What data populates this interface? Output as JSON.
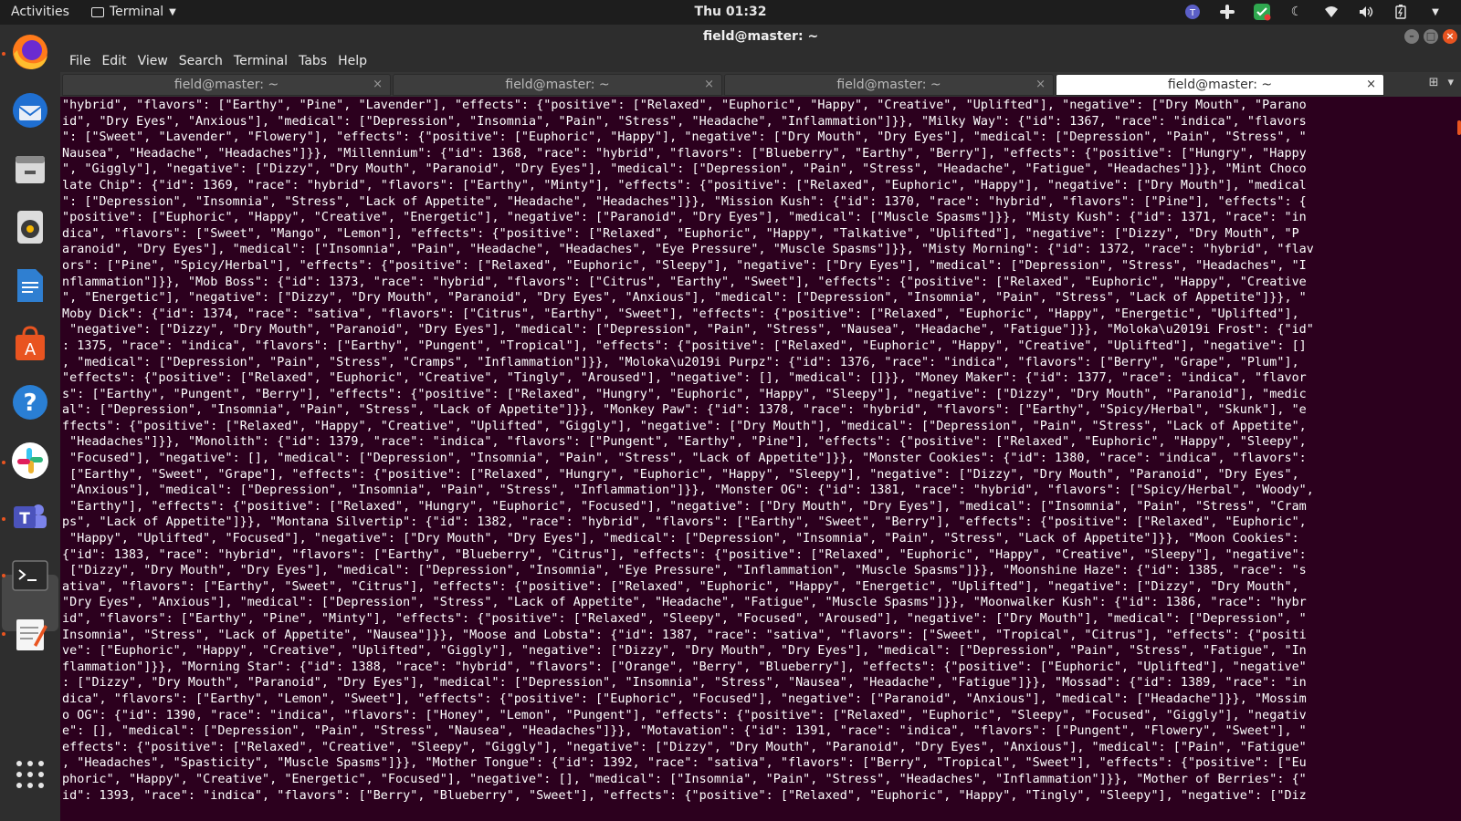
{
  "topbar": {
    "activities": "Activities",
    "app_name": "Terminal",
    "clock": "Thu 01:32"
  },
  "window": {
    "title": "field@master: ~"
  },
  "menu": [
    "File",
    "Edit",
    "View",
    "Search",
    "Terminal",
    "Tabs",
    "Help"
  ],
  "tabs": [
    {
      "label": "field@master: ~",
      "active": false
    },
    {
      "label": "field@master: ~",
      "active": false
    },
    {
      "label": "field@master: ~",
      "active": false
    },
    {
      "label": "field@master: ~",
      "active": true
    }
  ],
  "icons": {
    "tab_close": "×",
    "new_tab": "⊞",
    "tab_menu": "▾"
  },
  "colors": {
    "terminal_bg": "#2c001e",
    "accent": "#e95420"
  },
  "terminal_lines": [
    "\"hybrid\", \"flavors\": [\"Earthy\", \"Pine\", \"Lavender\"], \"effects\": {\"positive\": [\"Relaxed\", \"Euphoric\", \"Happy\", \"Creative\", \"Uplifted\"], \"negative\": [\"Dry Mouth\", \"Parano",
    "id\", \"Dry Eyes\", \"Anxious\"], \"medical\": [\"Depression\", \"Insomnia\", \"Pain\", \"Stress\", \"Headache\", \"Inflammation\"]}}, \"Milky Way\": {\"id\": 1367, \"race\": \"indica\", \"flavors",
    "\": [\"Sweet\", \"Lavender\", \"Flowery\"], \"effects\": {\"positive\": [\"Euphoric\", \"Happy\"], \"negative\": [\"Dry Mouth\", \"Dry Eyes\"], \"medical\": [\"Depression\", \"Pain\", \"Stress\", \"",
    "Nausea\", \"Headache\", \"Headaches\"]}}, \"Millennium\": {\"id\": 1368, \"race\": \"hybrid\", \"flavors\": [\"Blueberry\", \"Earthy\", \"Berry\"], \"effects\": {\"positive\": [\"Hungry\", \"Happy",
    "\", \"Giggly\"], \"negative\": [\"Dizzy\", \"Dry Mouth\", \"Paranoid\", \"Dry Eyes\"], \"medical\": [\"Depression\", \"Pain\", \"Stress\", \"Headache\", \"Fatigue\", \"Headaches\"]}}, \"Mint Choco",
    "late Chip\": {\"id\": 1369, \"race\": \"hybrid\", \"flavors\": [\"Earthy\", \"Minty\"], \"effects\": {\"positive\": [\"Relaxed\", \"Euphoric\", \"Happy\"], \"negative\": [\"Dry Mouth\"], \"medical",
    "\": [\"Depression\", \"Insomnia\", \"Stress\", \"Lack of Appetite\", \"Headache\", \"Headaches\"]}}, \"Mission Kush\": {\"id\": 1370, \"race\": \"hybrid\", \"flavors\": [\"Pine\"], \"effects\": {",
    "\"positive\": [\"Euphoric\", \"Happy\", \"Creative\", \"Energetic\"], \"negative\": [\"Paranoid\", \"Dry Eyes\"], \"medical\": [\"Muscle Spasms\"]}}, \"Misty Kush\": {\"id\": 1371, \"race\": \"in",
    "dica\", \"flavors\": [\"Sweet\", \"Mango\", \"Lemon\"], \"effects\": {\"positive\": [\"Relaxed\", \"Euphoric\", \"Happy\", \"Talkative\", \"Uplifted\"], \"negative\": [\"Dizzy\", \"Dry Mouth\", \"P",
    "aranoid\", \"Dry Eyes\"], \"medical\": [\"Insomnia\", \"Pain\", \"Headache\", \"Headaches\", \"Eye Pressure\", \"Muscle Spasms\"]}}, \"Misty Morning\": {\"id\": 1372, \"race\": \"hybrid\", \"flav",
    "ors\": [\"Pine\", \"Spicy/Herbal\"], \"effects\": {\"positive\": [\"Relaxed\", \"Euphoric\", \"Sleepy\"], \"negative\": [\"Dry Eyes\"], \"medical\": [\"Depression\", \"Stress\", \"Headaches\", \"I",
    "nflammation\"]}}, \"Mob Boss\": {\"id\": 1373, \"race\": \"hybrid\", \"flavors\": [\"Citrus\", \"Earthy\", \"Sweet\"], \"effects\": {\"positive\": [\"Relaxed\", \"Euphoric\", \"Happy\", \"Creative",
    "\", \"Energetic\"], \"negative\": [\"Dizzy\", \"Dry Mouth\", \"Paranoid\", \"Dry Eyes\", \"Anxious\"], \"medical\": [\"Depression\", \"Insomnia\", \"Pain\", \"Stress\", \"Lack of Appetite\"]}}, \"",
    "Moby Dick\": {\"id\": 1374, \"race\": \"sativa\", \"flavors\": [\"Citrus\", \"Earthy\", \"Sweet\"], \"effects\": {\"positive\": [\"Relaxed\", \"Euphoric\", \"Happy\", \"Energetic\", \"Uplifted\"],",
    " \"negative\": [\"Dizzy\", \"Dry Mouth\", \"Paranoid\", \"Dry Eyes\"], \"medical\": [\"Depression\", \"Pain\", \"Stress\", \"Nausea\", \"Headache\", \"Fatigue\"]}}, \"Moloka\\u2019i Frost\": {\"id\"",
    ": 1375, \"race\": \"indica\", \"flavors\": [\"Earthy\", \"Pungent\", \"Tropical\"], \"effects\": {\"positive\": [\"Relaxed\", \"Euphoric\", \"Happy\", \"Creative\", \"Uplifted\"], \"negative\": []",
    ", \"medical\": [\"Depression\", \"Pain\", \"Stress\", \"Cramps\", \"Inflammation\"]}}, \"Moloka\\u2019i Purpz\": {\"id\": 1376, \"race\": \"indica\", \"flavors\": [\"Berry\", \"Grape\", \"Plum\"],",
    "\"effects\": {\"positive\": [\"Relaxed\", \"Euphoric\", \"Creative\", \"Tingly\", \"Aroused\"], \"negative\": [], \"medical\": []}}, \"Money Maker\": {\"id\": 1377, \"race\": \"indica\", \"flavor",
    "s\": [\"Earthy\", \"Pungent\", \"Berry\"], \"effects\": {\"positive\": [\"Relaxed\", \"Hungry\", \"Euphoric\", \"Happy\", \"Sleepy\"], \"negative\": [\"Dizzy\", \"Dry Mouth\", \"Paranoid\"], \"medic",
    "al\": [\"Depression\", \"Insomnia\", \"Pain\", \"Stress\", \"Lack of Appetite\"]}}, \"Monkey Paw\": {\"id\": 1378, \"race\": \"hybrid\", \"flavors\": [\"Earthy\", \"Spicy/Herbal\", \"Skunk\"], \"e",
    "ffects\": {\"positive\": [\"Relaxed\", \"Happy\", \"Creative\", \"Uplifted\", \"Giggly\"], \"negative\": [\"Dry Mouth\"], \"medical\": [\"Depression\", \"Pain\", \"Stress\", \"Lack of Appetite\",",
    " \"Headaches\"]}}, \"Monolith\": {\"id\": 1379, \"race\": \"indica\", \"flavors\": [\"Pungent\", \"Earthy\", \"Pine\"], \"effects\": {\"positive\": [\"Relaxed\", \"Euphoric\", \"Happy\", \"Sleepy\",",
    " \"Focused\"], \"negative\": [], \"medical\": [\"Depression\", \"Insomnia\", \"Pain\", \"Stress\", \"Lack of Appetite\"]}}, \"Monster Cookies\": {\"id\": 1380, \"race\": \"indica\", \"flavors\":",
    " [\"Earthy\", \"Sweet\", \"Grape\"], \"effects\": {\"positive\": [\"Relaxed\", \"Hungry\", \"Euphoric\", \"Happy\", \"Sleepy\"], \"negative\": [\"Dizzy\", \"Dry Mouth\", \"Paranoid\", \"Dry Eyes\",",
    " \"Anxious\"], \"medical\": [\"Depression\", \"Insomnia\", \"Pain\", \"Stress\", \"Inflammation\"]}}, \"Monster OG\": {\"id\": 1381, \"race\": \"hybrid\", \"flavors\": [\"Spicy/Herbal\", \"Woody\",",
    " \"Earthy\"], \"effects\": {\"positive\": [\"Relaxed\", \"Hungry\", \"Euphoric\", \"Focused\"], \"negative\": [\"Dry Mouth\", \"Dry Eyes\"], \"medical\": [\"Insomnia\", \"Pain\", \"Stress\", \"Cram",
    "ps\", \"Lack of Appetite\"]}}, \"Montana Silvertip\": {\"id\": 1382, \"race\": \"hybrid\", \"flavors\": [\"Earthy\", \"Sweet\", \"Berry\"], \"effects\": {\"positive\": [\"Relaxed\", \"Euphoric\",",
    " \"Happy\", \"Uplifted\", \"Focused\"], \"negative\": [\"Dry Mouth\", \"Dry Eyes\"], \"medical\": [\"Depression\", \"Insomnia\", \"Pain\", \"Stress\", \"Lack of Appetite\"]}}, \"Moon Cookies\":",
    "{\"id\": 1383, \"race\": \"hybrid\", \"flavors\": [\"Earthy\", \"Blueberry\", \"Citrus\"], \"effects\": {\"positive\": [\"Relaxed\", \"Euphoric\", \"Happy\", \"Creative\", \"Sleepy\"], \"negative\":",
    " [\"Dizzy\", \"Dry Mouth\", \"Dry Eyes\"], \"medical\": [\"Depression\", \"Insomnia\", \"Eye Pressure\", \"Inflammation\", \"Muscle Spasms\"]}}, \"Moonshine Haze\": {\"id\": 1385, \"race\": \"s",
    "ativa\", \"flavors\": [\"Earthy\", \"Sweet\", \"Citrus\"], \"effects\": {\"positive\": [\"Relaxed\", \"Euphoric\", \"Happy\", \"Energetic\", \"Uplifted\"], \"negative\": [\"Dizzy\", \"Dry Mouth\",",
    "\"Dry Eyes\", \"Anxious\"], \"medical\": [\"Depression\", \"Stress\", \"Lack of Appetite\", \"Headache\", \"Fatigue\", \"Muscle Spasms\"]}}, \"Moonwalker Kush\": {\"id\": 1386, \"race\": \"hybr",
    "id\", \"flavors\": [\"Earthy\", \"Pine\", \"Minty\"], \"effects\": {\"positive\": [\"Relaxed\", \"Sleepy\", \"Focused\", \"Aroused\"], \"negative\": [\"Dry Mouth\"], \"medical\": [\"Depression\", \"",
    "Insomnia\", \"Stress\", \"Lack of Appetite\", \"Nausea\"]}}, \"Moose and Lobsta\": {\"id\": 1387, \"race\": \"sativa\", \"flavors\": [\"Sweet\", \"Tropical\", \"Citrus\"], \"effects\": {\"positi",
    "ve\": [\"Euphoric\", \"Happy\", \"Creative\", \"Uplifted\", \"Giggly\"], \"negative\": [\"Dizzy\", \"Dry Mouth\", \"Dry Eyes\"], \"medical\": [\"Depression\", \"Pain\", \"Stress\", \"Fatigue\", \"In",
    "flammation\"]}}, \"Morning Star\": {\"id\": 1388, \"race\": \"hybrid\", \"flavors\": [\"Orange\", \"Berry\", \"Blueberry\"], \"effects\": {\"positive\": [\"Euphoric\", \"Uplifted\"], \"negative\"",
    ": [\"Dizzy\", \"Dry Mouth\", \"Paranoid\", \"Dry Eyes\"], \"medical\": [\"Depression\", \"Insomnia\", \"Stress\", \"Nausea\", \"Headache\", \"Fatigue\"]}}, \"Mossad\": {\"id\": 1389, \"race\": \"in",
    "dica\", \"flavors\": [\"Earthy\", \"Lemon\", \"Sweet\"], \"effects\": {\"positive\": [\"Euphoric\", \"Focused\"], \"negative\": [\"Paranoid\", \"Anxious\"], \"medical\": [\"Headache\"]}}, \"Mossim",
    "o OG\": {\"id\": 1390, \"race\": \"indica\", \"flavors\": [\"Honey\", \"Lemon\", \"Pungent\"], \"effects\": {\"positive\": [\"Relaxed\", \"Euphoric\", \"Sleepy\", \"Focused\", \"Giggly\"], \"negativ",
    "e\": [], \"medical\": [\"Depression\", \"Pain\", \"Stress\", \"Nausea\", \"Headaches\"]}}, \"Motavation\": {\"id\": 1391, \"race\": \"indica\", \"flavors\": [\"Pungent\", \"Flowery\", \"Sweet\"], \"",
    "effects\": {\"positive\": [\"Relaxed\", \"Creative\", \"Sleepy\", \"Giggly\"], \"negative\": [\"Dizzy\", \"Dry Mouth\", \"Paranoid\", \"Dry Eyes\", \"Anxious\"], \"medical\": [\"Pain\", \"Fatigue\"",
    ", \"Headaches\", \"Spasticity\", \"Muscle Spasms\"]}}, \"Mother Tongue\": {\"id\": 1392, \"race\": \"sativa\", \"flavors\": [\"Berry\", \"Tropical\", \"Sweet\"], \"effects\": {\"positive\": [\"Eu",
    "phoric\", \"Happy\", \"Creative\", \"Energetic\", \"Focused\"], \"negative\": [], \"medical\": [\"Insomnia\", \"Pain\", \"Stress\", \"Headaches\", \"Inflammation\"]}}, \"Mother of Berries\": {\"",
    "id\": 1393, \"race\": \"indica\", \"flavors\": [\"Berry\", \"Blueberry\", \"Sweet\"], \"effects\": {\"positive\": [\"Relaxed\", \"Euphoric\", \"Happy\", \"Tingly\", \"Sleepy\"], \"negative\": [\"Diz"
  ]
}
